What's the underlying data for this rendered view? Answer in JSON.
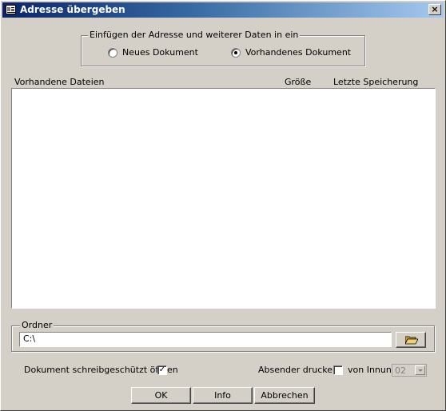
{
  "window": {
    "title": "Adresse übergeben",
    "close_glyph": "×"
  },
  "insert_group": {
    "legend": "Einfügen der Adresse und weiterer Daten in ein",
    "options": [
      {
        "label": "Neues Dokument",
        "selected": false
      },
      {
        "label": "Vorhandenes Dokument",
        "selected": true
      }
    ]
  },
  "file_list": {
    "columns": [
      "Vorhandene Dateien",
      "Größe",
      "Letzte Speicherung"
    ],
    "rows": []
  },
  "folder_group": {
    "legend": "Ordner",
    "path": "C:\\",
    "browse_icon": "folder-open-icon"
  },
  "options": {
    "readonly_label": "Dokument schreibgeschützt öffnen",
    "readonly_checked": true,
    "check_glyph": "✓",
    "sender_label": "Absender drucken",
    "sender_checked": false,
    "guild_label": "von Innung",
    "guild_value": "02"
  },
  "buttons": {
    "ok": "OK",
    "info": "Info",
    "cancel": "Abbrechen"
  }
}
